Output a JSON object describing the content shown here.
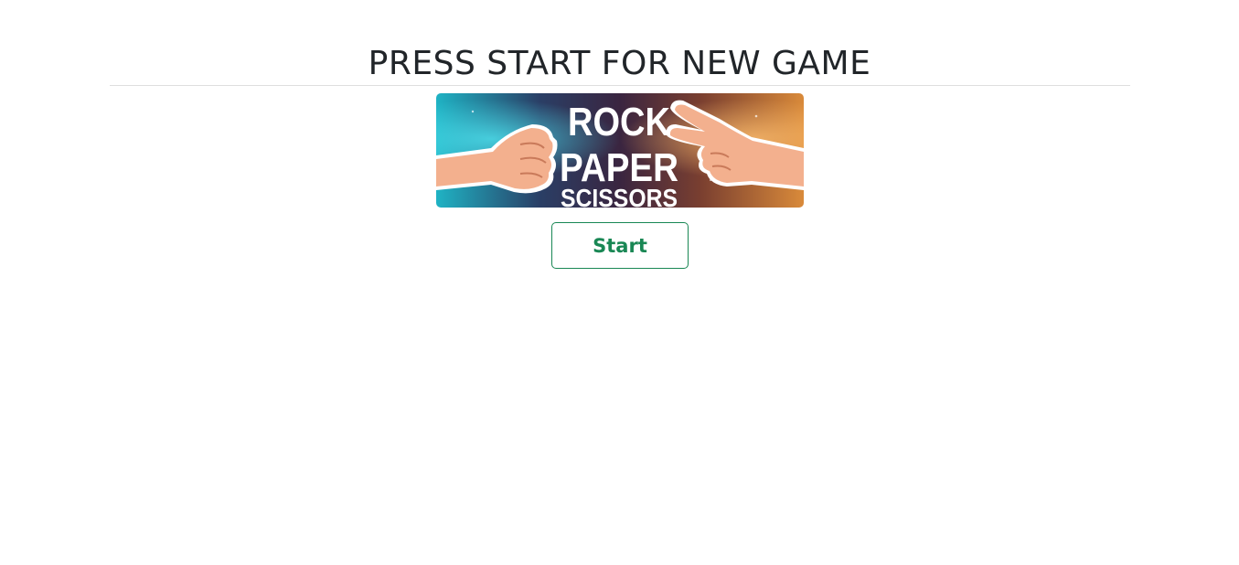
{
  "header": {
    "title": "PRESS START FOR NEW GAME"
  },
  "banner": {
    "line1": "ROCK",
    "line2": "PAPER",
    "line3": "SCISSORS",
    "left_hand_icon": "fist-icon",
    "right_hand_icon": "peace-sign-hand-icon"
  },
  "controls": {
    "start_label": "Start"
  },
  "colors": {
    "text": "#212529",
    "accent": "#198754",
    "banner_left": "#1fb3c4",
    "banner_right": "#d98a3a"
  }
}
